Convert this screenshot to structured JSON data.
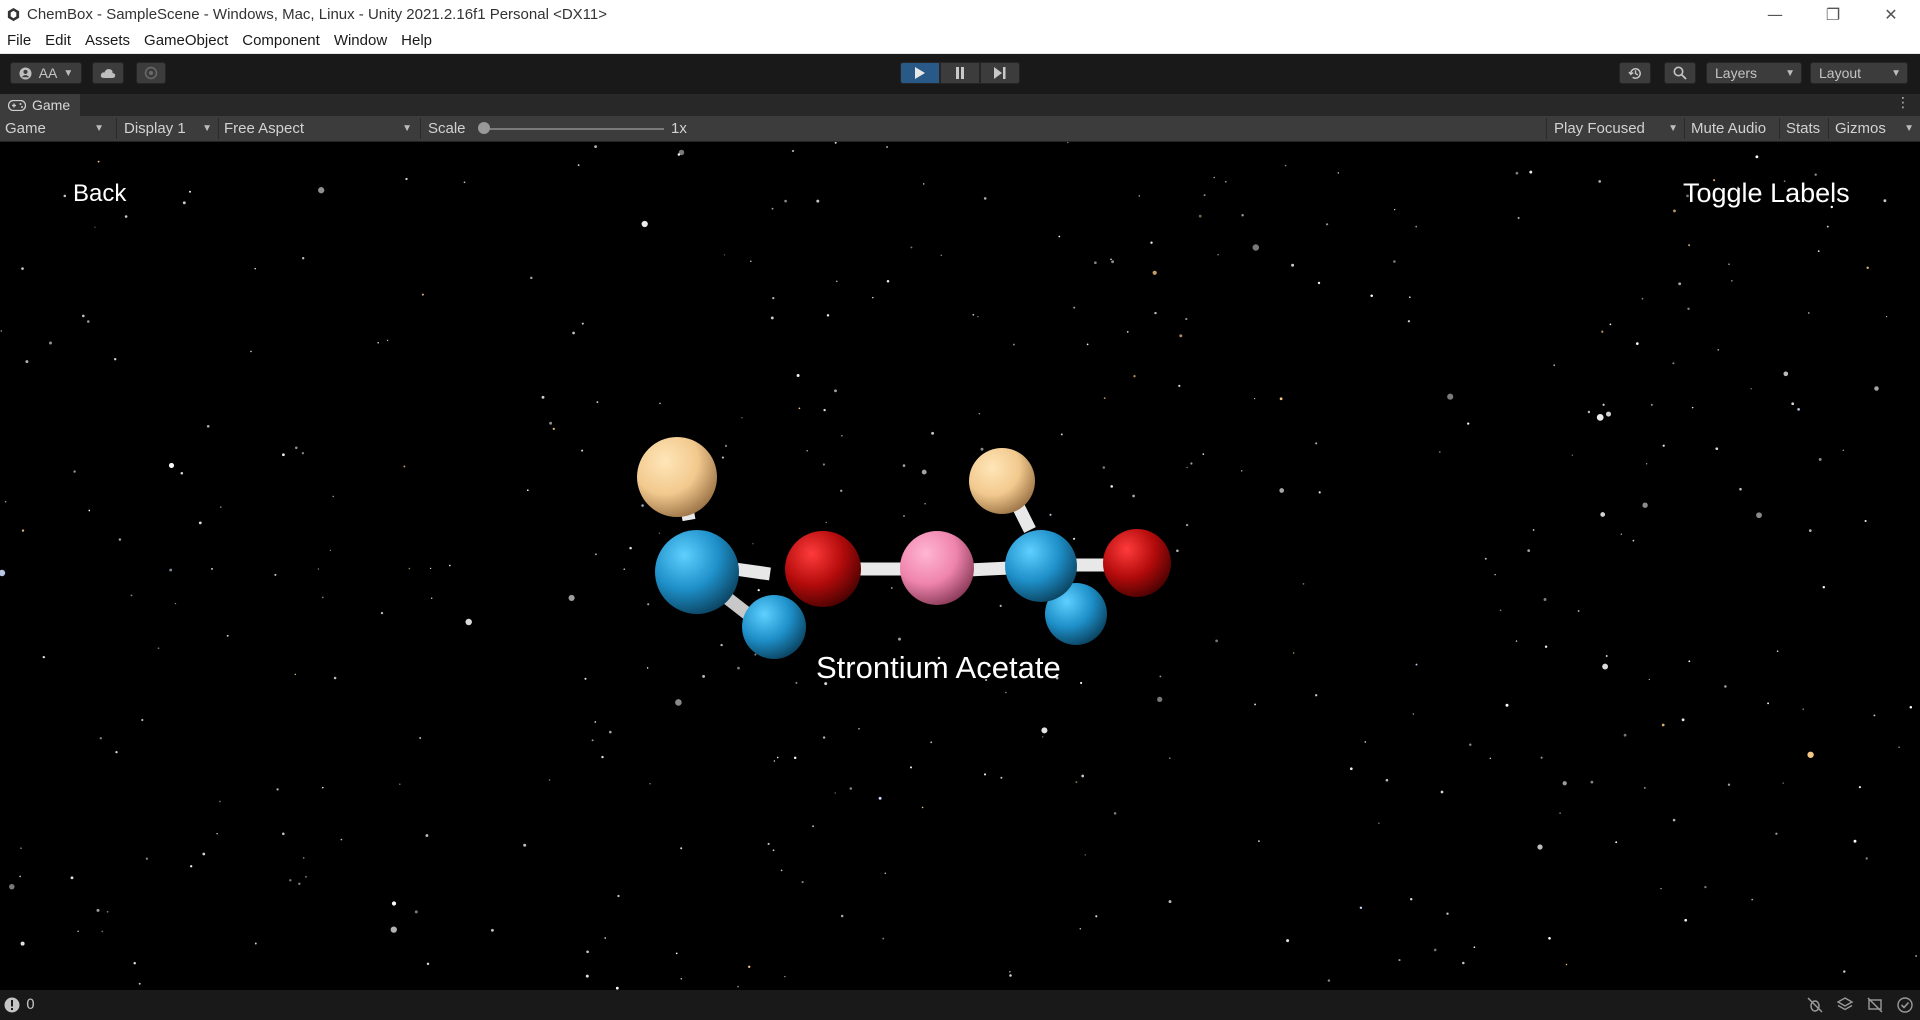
{
  "window": {
    "title": "ChemBox - SampleScene - Windows, Mac, Linux - Unity 2021.2.16f1 Personal <DX11>",
    "controls": [
      "—",
      "❐",
      "✕"
    ]
  },
  "menu": [
    "File",
    "Edit",
    "Assets",
    "GameObject",
    "Component",
    "Window",
    "Help"
  ],
  "toolbar": {
    "account_label": "AA",
    "layers_label": "Layers",
    "layout_label": "Layout"
  },
  "tab": {
    "label": "Game"
  },
  "game_toolbar": {
    "mode": "Game",
    "display": "Display 1",
    "aspect": "Free Aspect",
    "scale_label": "Scale",
    "scale_value": "1x",
    "play_focused": "Play Focused",
    "mute_audio": "Mute Audio",
    "stats": "Stats",
    "gizmos": "Gizmos"
  },
  "scene": {
    "back_label": "Back",
    "toggle_labels": "Toggle Labels",
    "molecule_name": "Strontium Acetate",
    "colors": {
      "carbon": "#1e8fc8",
      "oxygen": "#b30b0b",
      "hydrogen": "#f2c98e",
      "strontium": "#ef84ad",
      "bond": "#f2f2f2",
      "background": "#000000"
    }
  },
  "status": {
    "count": "0"
  }
}
